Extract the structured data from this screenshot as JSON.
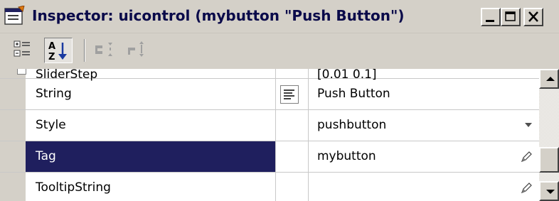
{
  "window": {
    "title": "Inspector:  uicontrol (mybutton \"Push Button\")"
  },
  "toolbar": {
    "buttons": [
      {
        "icon": "categorized-view-icon",
        "pressed": false
      },
      {
        "icon": "sort-alphabetical-icon",
        "pressed": true
      },
      {
        "icon": "expand-all-icon",
        "pressed": false
      },
      {
        "icon": "collapse-all-icon",
        "pressed": false
      }
    ]
  },
  "properties": [
    {
      "name": "SliderStep",
      "value": "[0.01 0.1]",
      "clipped": true
    },
    {
      "name": "String",
      "value": "Push Button",
      "editor": "list-edit-icon"
    },
    {
      "name": "Style",
      "value": "pushbutton",
      "control": "dropdown"
    },
    {
      "name": "Tag",
      "value": "mybutton",
      "selected": true,
      "control": "pencil-icon"
    },
    {
      "name": "TooltipString",
      "value": "",
      "control": "pencil-icon"
    }
  ],
  "colors": {
    "selection": "#1f1f5e",
    "title_text": "#0a0a4a",
    "chrome": "#d4d0c8"
  }
}
